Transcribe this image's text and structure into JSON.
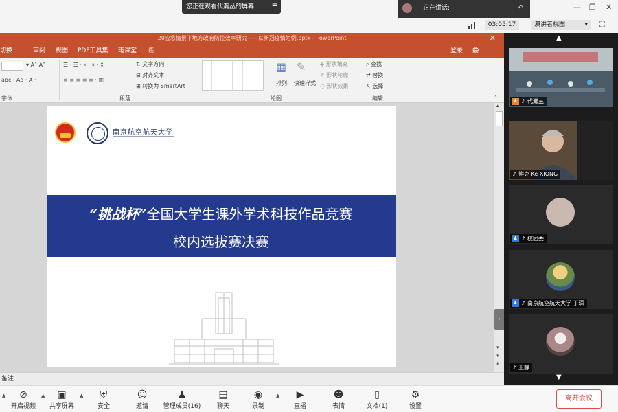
{
  "meeting": {
    "viewing_banner": "您正在观看代瀚丛的屏幕",
    "speaking_label": "正在讲话:",
    "timer": "03:05:17",
    "presenter_view": "演讲者视图"
  },
  "ppt": {
    "title": "20应急情景下地方政府防控效率研究——以新冠疫情为例.pptx - PowerPoint",
    "tabs": [
      "切换",
      "审阅",
      "视图",
      "PDF工具集",
      "雨课堂",
      "告诉我您想要做什么...",
      "登录",
      "共享"
    ],
    "ribbon": {
      "text_direction": "文字方向",
      "align_text": "对齐文本",
      "convert_smartart": "转换为 SmartArt",
      "arrange": "排列",
      "quick_styles": "快速样式",
      "shape_fill": "形状填充",
      "shape_outline": "形状轮廓",
      "shape_effects": "形状效果",
      "find": "查找",
      "replace": "替换",
      "select": "选择",
      "group_font": "字体",
      "group_paragraph": "段落",
      "group_drawing": "绘图",
      "group_editing": "编辑"
    },
    "slide": {
      "university_name": "南京航空航天大学",
      "banner_script": "“挑战杯”",
      "banner_line1": "全国大学生课外学术科技作品竞赛",
      "banner_line2": "校内选拔赛决赛"
    },
    "notes": "备注"
  },
  "participants": [
    {
      "name": "代瀚丛",
      "badge": "orange"
    },
    {
      "name": "熊克 Ke XIONG",
      "badge": ""
    },
    {
      "name": "校团委",
      "badge": "blue"
    },
    {
      "name": "南京航空航天大学 丁琛",
      "badge": "blue"
    },
    {
      "name": "王静",
      "badge": ""
    }
  ],
  "toolbar": {
    "video": "开启视频",
    "share": "共享屏幕",
    "security": "安全",
    "invite": "邀请",
    "members": "管理成员(16)",
    "chat": "聊天",
    "record": "录制",
    "live": "直播",
    "reactions": "表情",
    "docs": "文档(1)",
    "settings": "设置",
    "end_meeting": "离开会议"
  },
  "colors": {
    "ppt_accent": "#c4502d",
    "slide_banner": "#233a8e",
    "end_button": "#e24a4a"
  }
}
